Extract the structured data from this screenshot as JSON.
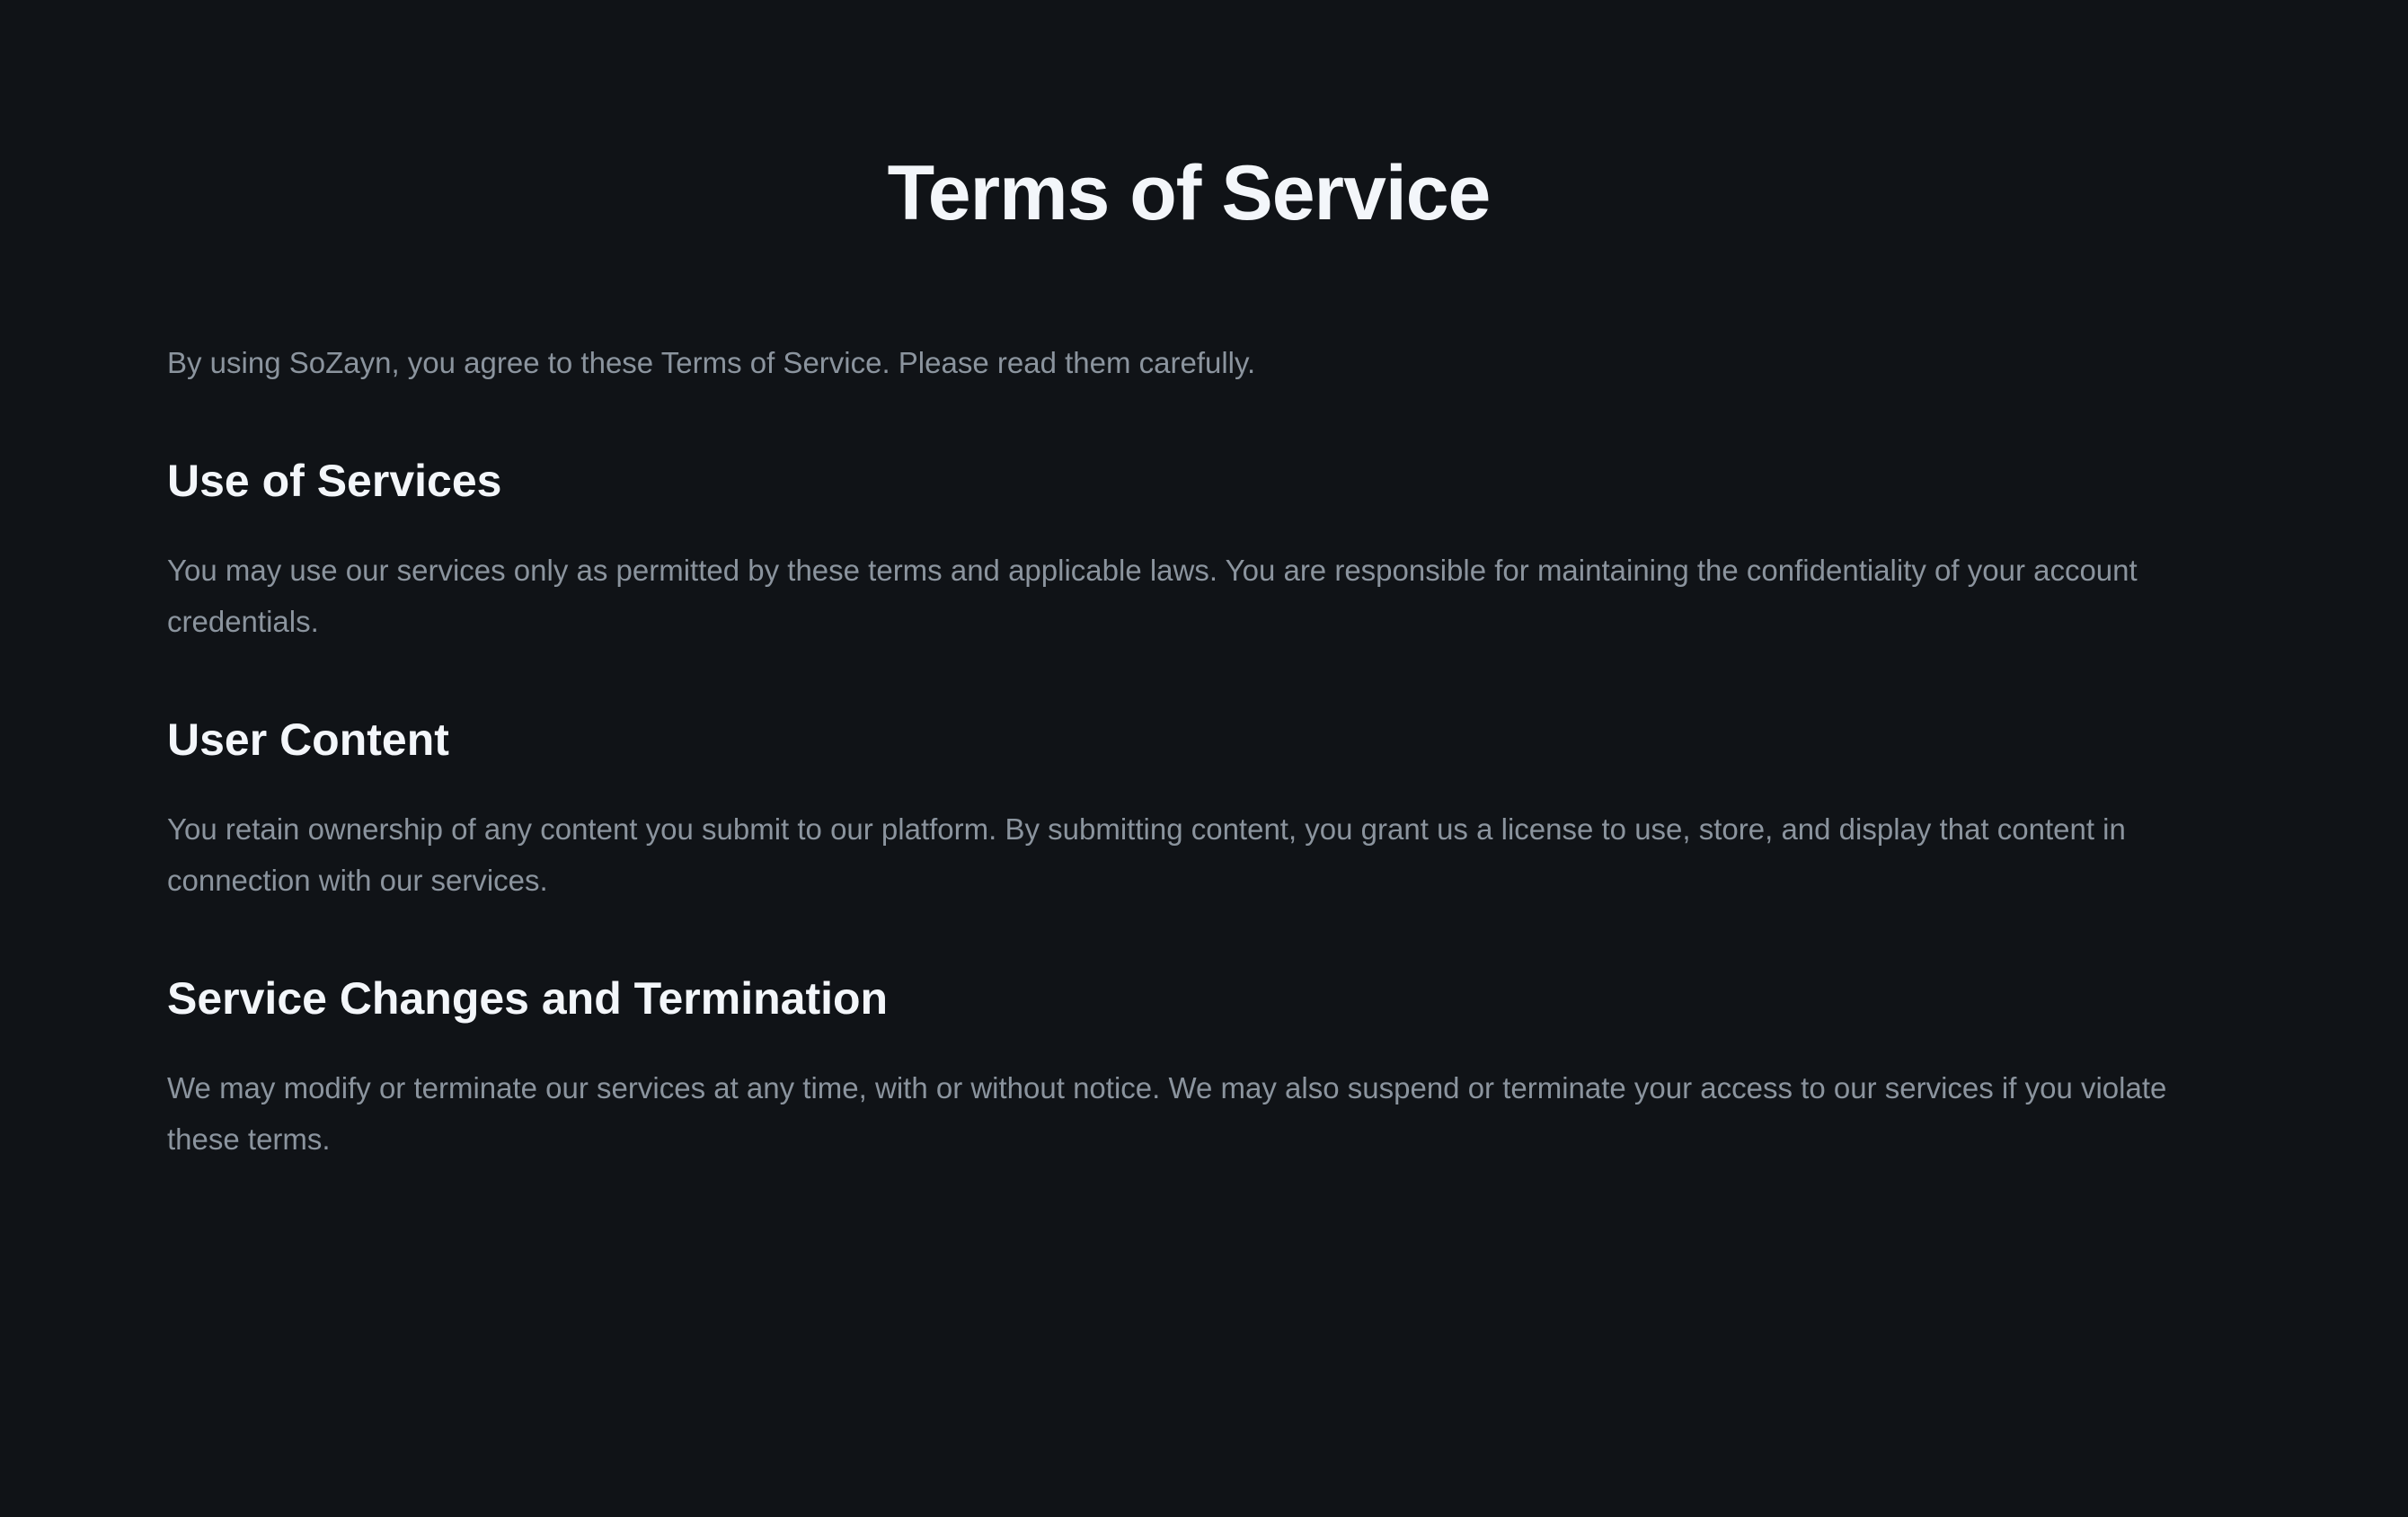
{
  "page": {
    "title": "Terms of Service",
    "intro": "By using SoZayn, you agree to these Terms of Service. Please read them carefully."
  },
  "sections": [
    {
      "heading": "Use of Services",
      "body": "You may use our services only as permitted by these terms and applicable laws. You are responsible for maintaining the confidentiality of your account credentials."
    },
    {
      "heading": "User Content",
      "body": "You retain ownership of any content you submit to our platform. By submitting content, you grant us a license to use, store, and display that content in connection with our services."
    },
    {
      "heading": "Service Changes and Termination",
      "body": "We may modify or terminate our services at any time, with or without notice. We may also suspend or terminate your access to our services if you violate these terms."
    }
  ],
  "colors": {
    "background": "#101317",
    "heading": "#f3f6fa",
    "body_text": "#8b949e"
  }
}
